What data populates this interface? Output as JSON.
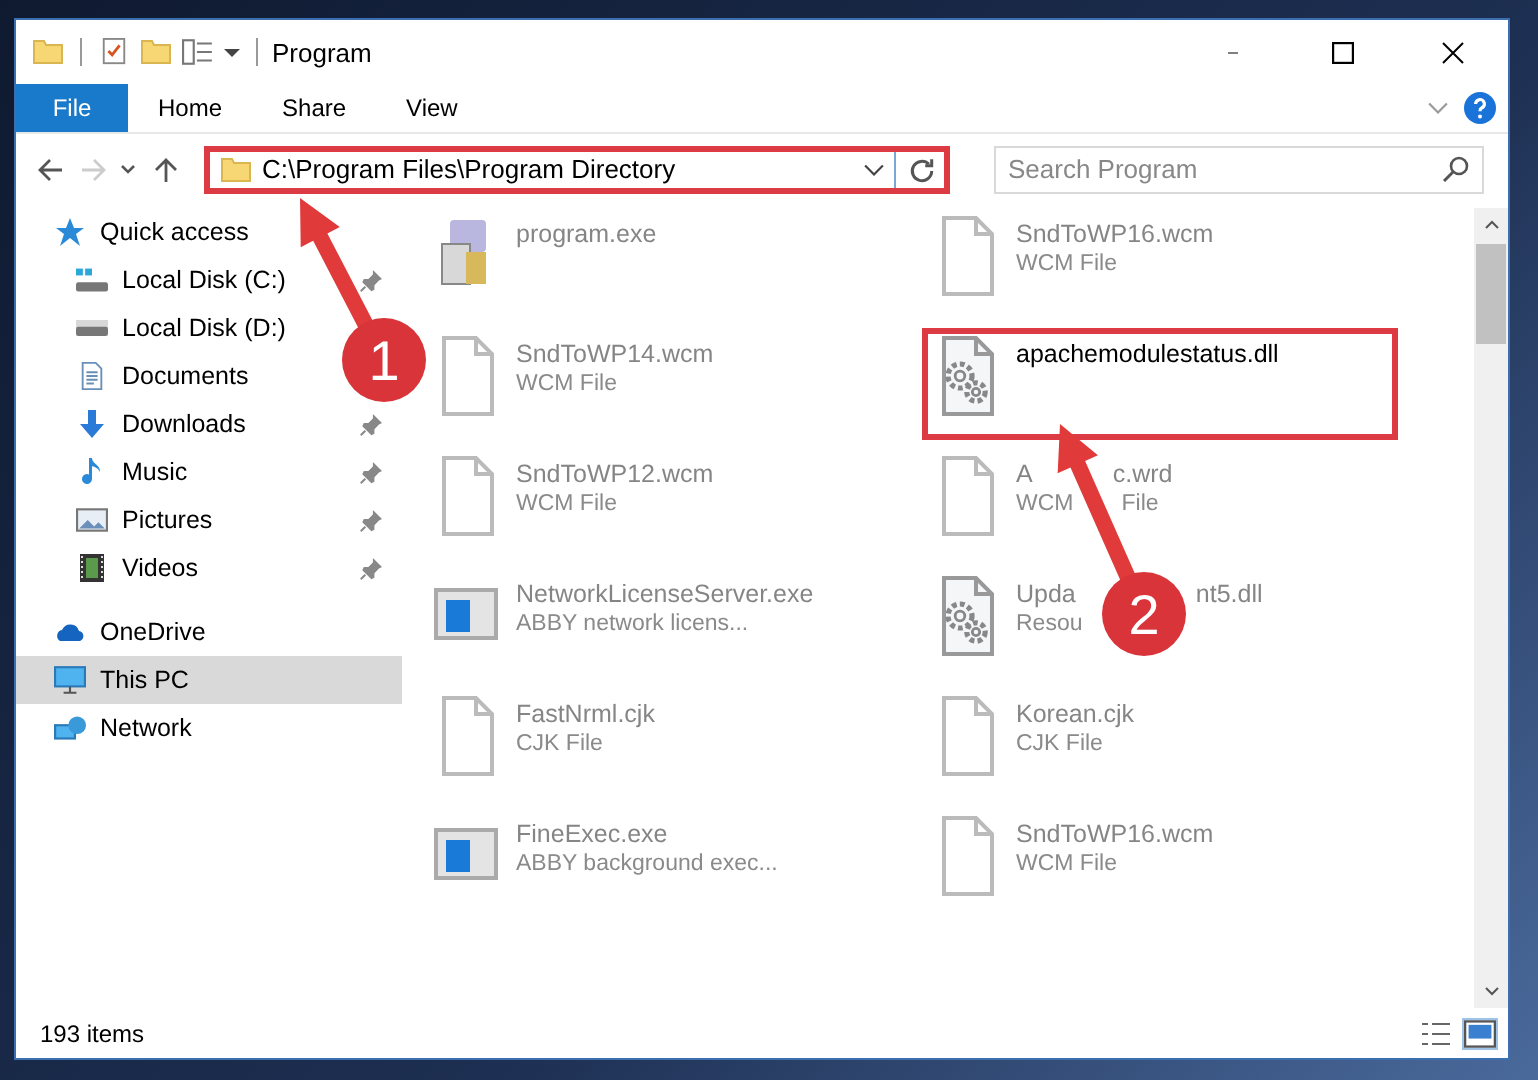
{
  "window": {
    "title": "Program"
  },
  "ribbon": {
    "tabs": [
      {
        "label": "File",
        "kind": "file"
      },
      {
        "label": "Home",
        "kind": "tab"
      },
      {
        "label": "Share",
        "kind": "tab"
      },
      {
        "label": "View",
        "kind": "tab"
      }
    ]
  },
  "address": {
    "path": "C:\\Program Files\\Program Directory",
    "highlighted": true
  },
  "search": {
    "placeholder": "Search Program"
  },
  "sidebar": {
    "items": [
      {
        "label": "Quick access",
        "selected": false,
        "children": [
          {
            "label": "Local Disk (C:)",
            "pinned": true,
            "selected": false
          },
          {
            "label": "Local Disk (D:)",
            "selected": false
          },
          {
            "label": "Documents",
            "selected": false
          },
          {
            "label": "Downloads",
            "pinned": true,
            "selected": false
          },
          {
            "label": "Music",
            "pinned": true,
            "selected": false
          },
          {
            "label": "Pictures",
            "pinned": true,
            "selected": false
          },
          {
            "label": "Videos",
            "pinned": true,
            "selected": false
          }
        ]
      },
      {
        "label": "OneDrive",
        "selected": false
      },
      {
        "label": "This PC",
        "selected": true
      },
      {
        "label": "Network",
        "selected": false
      }
    ]
  },
  "files": [
    {
      "name": "program.exe",
      "kind": "installer",
      "dimmed": true,
      "highlighted": false
    },
    {
      "name": "SndToWP16.wcm",
      "type": "WCM File",
      "kind": "blank",
      "dimmed": true,
      "highlighted": false
    },
    {
      "name": "SndToWP14.wcm",
      "type": "WCM File",
      "kind": "blank",
      "dimmed": true,
      "highlighted": false
    },
    {
      "name": "apachemodulestatus.dll",
      "kind": "gears",
      "dimmed": false,
      "highlighted": true
    },
    {
      "name": "SndToWP12.wcm",
      "type": "WCM File",
      "kind": "blank",
      "dimmed": true,
      "highlighted": false
    },
    {
      "name": [
        "A",
        "c.wrd"
      ],
      "type": [
        "WCM",
        "File"
      ],
      "kind": "blank",
      "dimmed": true,
      "highlighted": false
    },
    {
      "name": "NetworkLicenseServer.exe",
      "type": "ABBY network licens...",
      "kind": "app",
      "dimmed": true,
      "highlighted": false
    },
    {
      "name": [
        "Upda",
        "nt5.dll"
      ],
      "type": "Resou",
      "kind": "gears",
      "dimmed": true,
      "highlighted": false
    },
    {
      "name": "FastNrml.cjk",
      "type": "CJK File",
      "kind": "blank",
      "dimmed": true,
      "highlighted": false
    },
    {
      "name": "Korean.cjk",
      "type": "CJK File",
      "kind": "blank",
      "dimmed": true,
      "highlighted": false
    },
    {
      "name": "FineExec.exe",
      "type": "ABBY background exec...",
      "kind": "app",
      "dimmed": true,
      "highlighted": false
    },
    {
      "name": "SndToWP16.wcm",
      "type": "WCM File",
      "kind": "blank",
      "dimmed": true,
      "highlighted": false
    }
  ],
  "status_bar": {
    "count": "193 items"
  },
  "annotations": [
    {
      "label": "1"
    },
    {
      "label": "2"
    }
  ]
}
